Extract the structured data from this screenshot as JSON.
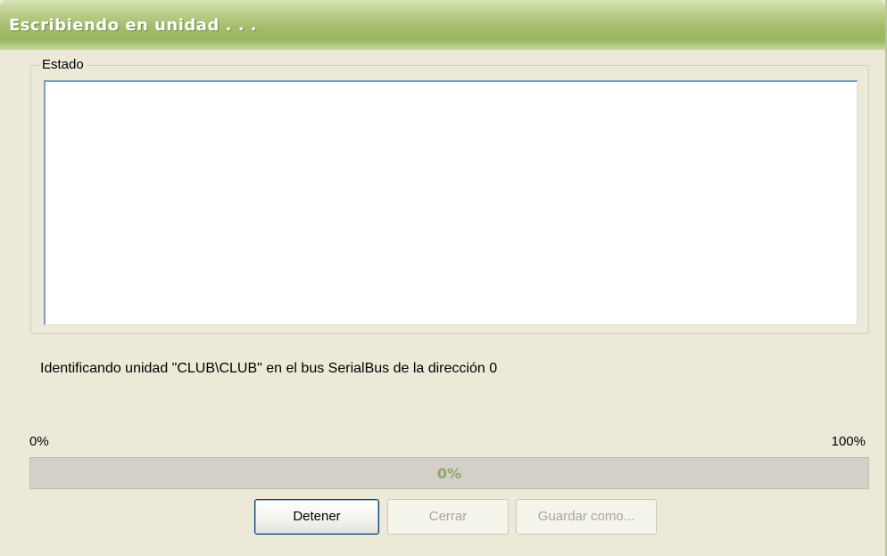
{
  "window": {
    "title": "Escribiendo en unidad . . ."
  },
  "status_group": {
    "legend": "Estado",
    "log_text": ""
  },
  "message": "Identificando unidad \"CLUB\\CLUB\" en el bus SerialBus de la dirección 0",
  "progress": {
    "min_label": "0%",
    "max_label": "100%",
    "value_text": "0%",
    "value": 0
  },
  "buttons": {
    "stop": "Detener",
    "close": "Cerrar",
    "save_as": "Guardar como..."
  },
  "colors": {
    "titlebar": "#a3bd6c",
    "dialog_bg": "#ece9d8",
    "progress_text": "#8fa66a"
  }
}
